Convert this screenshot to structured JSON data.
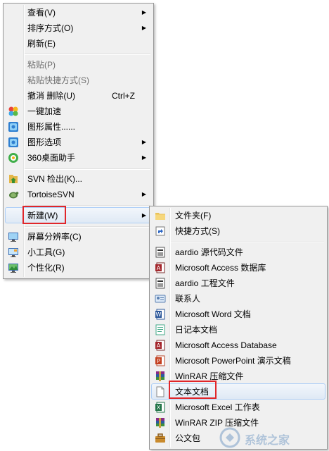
{
  "main_menu": {
    "items": [
      {
        "label": "查看(V)",
        "submenu": true
      },
      {
        "label": "排序方式(O)",
        "submenu": true
      },
      {
        "label": "刷新(E)"
      },
      {
        "label": "粘贴(P)",
        "disabled": true
      },
      {
        "label": "粘贴快捷方式(S)",
        "disabled": true
      },
      {
        "label": "撤消 删除(U)",
        "shortcut": "Ctrl+Z"
      },
      {
        "label": "一键加速",
        "icon": "speedup-icon"
      },
      {
        "label": "图形属性......",
        "icon": "graphics-properties-icon"
      },
      {
        "label": "图形选项",
        "icon": "graphics-options-icon",
        "submenu": true
      },
      {
        "label": "360桌面助手",
        "icon": "360-desktop-icon",
        "submenu": true
      },
      {
        "label": "SVN 检出(K)...",
        "icon": "svn-checkout-icon"
      },
      {
        "label": "TortoiseSVN",
        "icon": "tortoisesvn-icon",
        "submenu": true
      },
      {
        "label": "新建(W)",
        "submenu": true,
        "highlighted": true
      },
      {
        "label": "屏幕分辨率(C)",
        "icon": "screen-resolution-icon"
      },
      {
        "label": "小工具(G)",
        "icon": "gadgets-icon"
      },
      {
        "label": "个性化(R)",
        "icon": "personalize-icon"
      }
    ]
  },
  "new_submenu": {
    "items": [
      {
        "label": "文件夹(F)",
        "icon": "folder-icon"
      },
      {
        "label": "快捷方式(S)",
        "icon": "shortcut-icon"
      },
      {
        "label": "aardio 源代码文件",
        "icon": "aardio-source-icon"
      },
      {
        "label": "Microsoft Access 数据库",
        "icon": "access-db-icon"
      },
      {
        "label": "aardio 工程文件",
        "icon": "aardio-project-icon"
      },
      {
        "label": "联系人",
        "icon": "contact-icon"
      },
      {
        "label": "Microsoft Word 文档",
        "icon": "word-icon"
      },
      {
        "label": "日记本文档",
        "icon": "journal-icon"
      },
      {
        "label": "Microsoft Access Database",
        "icon": "access-database-icon"
      },
      {
        "label": "Microsoft PowerPoint 演示文稿",
        "icon": "powerpoint-icon"
      },
      {
        "label": "WinRAR 压缩文件",
        "icon": "winrar-icon"
      },
      {
        "label": "文本文档",
        "icon": "text-document-icon",
        "highlighted": true
      },
      {
        "label": "Microsoft Excel 工作表",
        "icon": "excel-icon"
      },
      {
        "label": "WinRAR ZIP 压缩文件",
        "icon": "winrar-zip-icon"
      },
      {
        "label": "公文包",
        "icon": "briefcase-icon"
      }
    ]
  },
  "watermark": {
    "text": "系统之家"
  },
  "colors": {
    "highlight_box": "#e0262a",
    "menu_bg": "#f0f0f0"
  }
}
